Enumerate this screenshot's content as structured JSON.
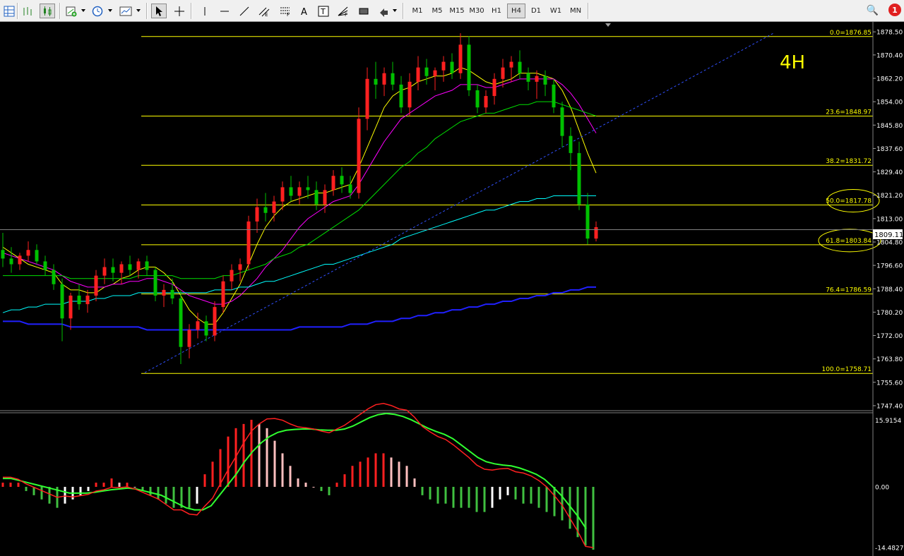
{
  "toolbar": {
    "timeframes": [
      "M1",
      "M5",
      "M15",
      "M30",
      "H1",
      "H4",
      "D1",
      "W1",
      "MN"
    ],
    "active_timeframe": "H4",
    "notification_count": "1"
  },
  "chart_data": {
    "type": "candlestick",
    "period_label": "4H",
    "current_price": "1809.11",
    "ylim": [
      1745.9,
      1882.0
    ],
    "price_axis_ticks": [
      "1878.50",
      "1870.40",
      "1862.20",
      "1854.00",
      "1845.80",
      "1837.60",
      "1829.40",
      "1821.20",
      "1813.00",
      "1804.80",
      "1796.60",
      "1788.40",
      "1780.20",
      "1772.00",
      "1763.80",
      "1755.60",
      "1747.40"
    ],
    "fibonacci": [
      {
        "label": "0.0=1876.85",
        "level": 0.0,
        "price": 1876.85
      },
      {
        "label": "23.6=1848.97",
        "level": 23.6,
        "price": 1848.97
      },
      {
        "label": "38.2=1831.72",
        "level": 38.2,
        "price": 1831.72
      },
      {
        "label": "50.0=1817.78",
        "level": 50.0,
        "price": 1817.78
      },
      {
        "label": "61.8=1803.84",
        "level": 61.8,
        "price": 1803.84
      },
      {
        "label": "76.4=1786.59",
        "level": 76.4,
        "price": 1786.59
      },
      {
        "label": "100.0=1758.71",
        "level": 100.0,
        "price": 1758.71
      }
    ],
    "highlighted_levels": [
      "50.0=1817.78",
      "61.8=1803.84"
    ],
    "candles": [
      [
        1802,
        1808,
        1796,
        1799
      ],
      [
        1799,
        1803,
        1794,
        1797
      ],
      [
        1797,
        1801,
        1795,
        1800
      ],
      [
        1800,
        1805,
        1798,
        1802
      ],
      [
        1802,
        1804,
        1797,
        1798
      ],
      [
        1798,
        1800,
        1793,
        1795
      ],
      [
        1795,
        1797,
        1788,
        1790
      ],
      [
        1790,
        1792,
        1770,
        1778
      ],
      [
        1778,
        1787,
        1774,
        1786
      ],
      [
        1786,
        1790,
        1781,
        1783
      ],
      [
        1783,
        1788,
        1780,
        1786
      ],
      [
        1786,
        1795,
        1784,
        1793
      ],
      [
        1793,
        1799,
        1790,
        1796
      ],
      [
        1796,
        1799,
        1791,
        1794
      ],
      [
        1794,
        1798,
        1790,
        1797
      ],
      [
        1797,
        1800,
        1793,
        1795
      ],
      [
        1795,
        1799,
        1792,
        1798
      ],
      [
        1798,
        1800,
        1793,
        1795
      ],
      [
        1795,
        1796,
        1784,
        1786
      ],
      [
        1786,
        1790,
        1782,
        1788
      ],
      [
        1788,
        1792,
        1783,
        1785
      ],
      [
        1785,
        1788,
        1762,
        1768
      ],
      [
        1768,
        1776,
        1764,
        1774
      ],
      [
        1774,
        1780,
        1771,
        1777
      ],
      [
        1777,
        1779,
        1770,
        1772
      ],
      [
        1772,
        1784,
        1770,
        1782
      ],
      [
        1782,
        1793,
        1780,
        1791
      ],
      [
        1791,
        1797,
        1788,
        1795
      ],
      [
        1795,
        1799,
        1791,
        1797
      ],
      [
        1797,
        1814,
        1795,
        1812
      ],
      [
        1812,
        1820,
        1808,
        1817
      ],
      [
        1817,
        1822,
        1812,
        1815
      ],
      [
        1815,
        1821,
        1812,
        1819
      ],
      [
        1819,
        1826,
        1816,
        1824
      ],
      [
        1824,
        1828,
        1819,
        1821
      ],
      [
        1821,
        1826,
        1818,
        1824
      ],
      [
        1824,
        1828,
        1820,
        1823
      ],
      [
        1823,
        1826,
        1816,
        1818
      ],
      [
        1818,
        1825,
        1815,
        1823
      ],
      [
        1823,
        1830,
        1821,
        1828
      ],
      [
        1828,
        1831,
        1822,
        1825
      ],
      [
        1825,
        1828,
        1820,
        1822
      ],
      [
        1822,
        1852,
        1820,
        1848
      ],
      [
        1848,
        1866,
        1844,
        1862
      ],
      [
        1862,
        1868,
        1855,
        1860
      ],
      [
        1860,
        1866,
        1856,
        1864
      ],
      [
        1864,
        1868,
        1858,
        1860
      ],
      [
        1860,
        1863,
        1850,
        1852
      ],
      [
        1852,
        1864,
        1849,
        1861
      ],
      [
        1861,
        1870,
        1858,
        1866
      ],
      [
        1866,
        1869,
        1860,
        1863
      ],
      [
        1863,
        1866,
        1858,
        1865
      ],
      [
        1865,
        1870,
        1861,
        1868
      ],
      [
        1868,
        1871,
        1862,
        1864
      ],
      [
        1864,
        1878,
        1862,
        1874
      ],
      [
        1874,
        1877,
        1856,
        1858
      ],
      [
        1858,
        1860,
        1850,
        1852
      ],
      [
        1852,
        1858,
        1850,
        1856
      ],
      [
        1856,
        1864,
        1853,
        1862
      ],
      [
        1862,
        1869,
        1859,
        1866
      ],
      [
        1866,
        1870,
        1861,
        1868
      ],
      [
        1868,
        1872,
        1862,
        1864
      ],
      [
        1864,
        1866,
        1858,
        1861
      ],
      [
        1861,
        1865,
        1855,
        1863
      ],
      [
        1863,
        1865,
        1856,
        1860
      ],
      [
        1860,
        1862,
        1850,
        1852
      ],
      [
        1852,
        1854,
        1838,
        1842
      ],
      [
        1842,
        1845,
        1830,
        1836
      ],
      [
        1836,
        1840,
        1816,
        1818
      ],
      [
        1818,
        1822,
        1804,
        1806
      ],
      [
        1806,
        1812,
        1805,
        1810
      ]
    ],
    "ma_series": [
      {
        "color": "#ffff00",
        "values": [
          1803,
          1801,
          1799,
          1797,
          1796,
          1795,
          1794,
          1790,
          1788,
          1788,
          1787,
          1787,
          1789,
          1790,
          1792,
          1793,
          1795,
          1796,
          1796,
          1794,
          1791,
          1786,
          1781,
          1778,
          1776,
          1776,
          1780,
          1785,
          1790,
          1797,
          1804,
          1810,
          1814,
          1817,
          1819,
          1820,
          1821,
          1822,
          1822,
          1823,
          1824,
          1825,
          1831,
          1838,
          1845,
          1852,
          1856,
          1858,
          1859,
          1861,
          1862,
          1863,
          1863,
          1864,
          1866,
          1865,
          1863,
          1861,
          1860,
          1861,
          1862,
          1864,
          1864,
          1864,
          1863,
          1862,
          1858,
          1852,
          1844,
          1836,
          1829
        ]
      },
      {
        "color": "#ff00ff",
        "values": [
          1801,
          1800,
          1799,
          1798,
          1797,
          1796,
          1795,
          1793,
          1791,
          1790,
          1789,
          1789,
          1789,
          1790,
          1790,
          1791,
          1791,
          1792,
          1792,
          1791,
          1790,
          1788,
          1786,
          1785,
          1784,
          1783,
          1783,
          1784,
          1786,
          1789,
          1792,
          1796,
          1799,
          1802,
          1806,
          1810,
          1813,
          1815,
          1817,
          1819,
          1820,
          1821,
          1825,
          1830,
          1835,
          1840,
          1844,
          1848,
          1850,
          1852,
          1854,
          1856,
          1857,
          1858,
          1860,
          1860,
          1860,
          1859,
          1859,
          1860,
          1861,
          1862,
          1862,
          1862,
          1862,
          1862,
          1860,
          1857,
          1853,
          1848,
          1843
        ]
      },
      {
        "color": "#00e000",
        "values": [
          1793,
          1793,
          1793,
          1793,
          1793,
          1793,
          1793,
          1793,
          1792,
          1792,
          1792,
          1792,
          1792,
          1792,
          1792,
          1792,
          1793,
          1793,
          1793,
          1793,
          1793,
          1792,
          1792,
          1792,
          1792,
          1792,
          1793,
          1793,
          1794,
          1795,
          1796,
          1797,
          1799,
          1800,
          1801,
          1803,
          1804,
          1806,
          1808,
          1810,
          1812,
          1814,
          1816,
          1819,
          1822,
          1825,
          1828,
          1831,
          1833,
          1836,
          1838,
          1841,
          1843,
          1845,
          1847,
          1848,
          1849,
          1850,
          1850,
          1851,
          1852,
          1853,
          1853,
          1854,
          1854,
          1854,
          1853,
          1852,
          1851,
          1850,
          1849
        ]
      },
      {
        "color": "#00ffff",
        "values": [
          1780,
          1781,
          1781,
          1782,
          1782,
          1783,
          1783,
          1783,
          1784,
          1784,
          1784,
          1785,
          1785,
          1786,
          1786,
          1786,
          1787,
          1787,
          1787,
          1787,
          1787,
          1787,
          1787,
          1787,
          1787,
          1788,
          1788,
          1788,
          1789,
          1789,
          1790,
          1791,
          1791,
          1792,
          1793,
          1794,
          1795,
          1796,
          1797,
          1797,
          1798,
          1799,
          1800,
          1801,
          1802,
          1803,
          1804,
          1806,
          1807,
          1808,
          1809,
          1810,
          1811,
          1812,
          1813,
          1814,
          1815,
          1816,
          1816,
          1817,
          1818,
          1819,
          1819,
          1820,
          1820,
          1821,
          1821,
          1821,
          1821,
          1821,
          1821
        ]
      },
      {
        "color": "#2020ff",
        "values": [
          1777,
          1777,
          1777,
          1776,
          1776,
          1776,
          1776,
          1776,
          1775,
          1775,
          1775,
          1775,
          1775,
          1775,
          1775,
          1775,
          1775,
          1774,
          1774,
          1774,
          1774,
          1774,
          1774,
          1774,
          1774,
          1774,
          1774,
          1774,
          1774,
          1774,
          1774,
          1774,
          1774,
          1774,
          1774,
          1775,
          1775,
          1775,
          1775,
          1775,
          1775,
          1776,
          1776,
          1776,
          1777,
          1777,
          1777,
          1778,
          1778,
          1779,
          1779,
          1780,
          1780,
          1781,
          1781,
          1782,
          1782,
          1783,
          1783,
          1784,
          1784,
          1785,
          1785,
          1786,
          1786,
          1787,
          1787,
          1788,
          1788,
          1789,
          1789
        ]
      }
    ],
    "trendline": {
      "from": [
        0,
        1759
      ],
      "to": [
        84,
        1878
      ]
    },
    "macd": {
      "axis_ticks": [
        "15.9154",
        "0.00",
        "-14.4827"
      ],
      "ylim": [
        -16.5,
        17.0
      ],
      "histogram": [
        1,
        1,
        1,
        -1,
        -2,
        -3,
        -4,
        -5,
        -4,
        -3,
        -2,
        -1,
        1,
        1,
        2,
        1,
        1,
        0,
        -1,
        -2,
        -3,
        -4,
        -5,
        -5,
        -5,
        -4,
        3,
        6,
        9,
        12,
        14,
        15,
        16,
        15,
        14,
        11,
        8,
        5,
        2,
        1,
        0,
        -1,
        -2,
        1,
        3,
        5,
        6,
        7,
        8,
        8,
        7,
        6,
        5,
        2,
        -2,
        -3,
        -4,
        -4,
        -5,
        -5,
        -5,
        -6,
        -6,
        -5,
        -3,
        -2,
        -3,
        -4,
        -4,
        -5,
        -6,
        -7,
        -8,
        -10,
        -12,
        -14,
        -15
      ],
      "signal": [
        2,
        2,
        1.5,
        1,
        0.5,
        0,
        -0.5,
        -1,
        -1.5,
        -1.5,
        -1.5,
        -1.3,
        -1,
        -0.7,
        -0.5,
        -0.3,
        -0.5,
        -1,
        -1.5,
        -2,
        -3,
        -4,
        -5,
        -5.5,
        -5.5,
        -4.5,
        -2,
        0.5,
        3,
        6,
        8.5,
        10.5,
        12,
        13,
        13.5,
        13.7,
        13.8,
        13.8,
        13.6,
        13.5,
        13.5,
        13.8,
        14.5,
        15.5,
        16.5,
        17.2,
        17.5,
        17.3,
        16.8,
        16,
        15,
        14,
        13.2,
        12.5,
        11.5,
        10,
        8.5,
        7,
        6,
        5.5,
        5.2,
        5,
        4.5,
        3.8,
        3,
        1.8,
        0,
        -2,
        -4.5,
        -7,
        -10
      ]
    }
  }
}
